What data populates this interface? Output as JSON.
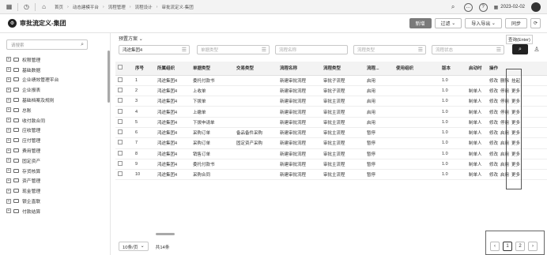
{
  "topbar": {
    "crumbs": [
      "首页",
      "动态建模平台",
      "流程管理",
      "流程设计",
      "审批流定义-集团"
    ],
    "date": "2023-02-02"
  },
  "header": {
    "title": "审批流定义-集团",
    "buttons": {
      "add": "新增",
      "filter": "过滤",
      "import_export": "导入导出",
      "sync": "同步"
    }
  },
  "sidebar": {
    "search_placeholder": "请搜索",
    "items": [
      {
        "label": "权限管理"
      },
      {
        "label": "基础数据"
      },
      {
        "label": "企业绩效管理平台"
      },
      {
        "label": "企业报表"
      },
      {
        "label": "基础档案及规则"
      },
      {
        "label": "总账"
      },
      {
        "label": "收付款合同"
      },
      {
        "label": "应收管理"
      },
      {
        "label": "应付管理"
      },
      {
        "label": "费用管理"
      },
      {
        "label": "固定资产"
      },
      {
        "label": "存货核算"
      },
      {
        "label": "资产管理"
      },
      {
        "label": "现金管理"
      },
      {
        "label": "银企直联"
      },
      {
        "label": "付款结算"
      }
    ]
  },
  "filters": {
    "scheme_label": "预置方案",
    "scheme_value": "",
    "org_value": "鸿途集团4",
    "doc_type_placeholder": "单据类型",
    "flow_name_placeholder": "流程名称",
    "flow_type_placeholder": "流程类型",
    "flow_status_placeholder": "流程状态",
    "search_tip": "查询(Enter)"
  },
  "table": {
    "columns": [
      "",
      "序号",
      "所属组织",
      "单据类型",
      "交易类型",
      "流程名称",
      "流程类型",
      "流程...",
      "使用组织",
      "版本",
      "启动时",
      "操作"
    ],
    "rows": [
      {
        "no": "1",
        "org": "鸿途集团4",
        "doc": "委托付款书",
        "trade": "",
        "name": "新建审批流程",
        "type": "审批子流程",
        "status": "启用",
        "use_org": "",
        "ver": "1.0",
        "start": "",
        "op1": "修改",
        "op2": "删除",
        "op3": "挂起"
      },
      {
        "no": "2",
        "org": "鸿途集团4",
        "doc": "上收单",
        "trade": "",
        "name": "新建审批流程",
        "type": "审批子流程",
        "status": "启用",
        "use_org": "",
        "ver": "1.0",
        "start": "制单人",
        "op1": "修改",
        "op2": "停用",
        "op3": "更多"
      },
      {
        "no": "3",
        "org": "鸿途集团4",
        "doc": "下拨单",
        "trade": "",
        "name": "新建审批流程",
        "type": "审批主流程",
        "status": "启用",
        "use_org": "",
        "ver": "1.0",
        "start": "制单人",
        "op1": "修改",
        "op2": "停用",
        "op3": "更多"
      },
      {
        "no": "4",
        "org": "鸿途集团4",
        "doc": "上缴单",
        "trade": "",
        "name": "新建审批流程",
        "type": "审批主流程",
        "status": "启用",
        "use_org": "",
        "ver": "1.0",
        "start": "制单人",
        "op1": "修改",
        "op2": "停用",
        "op3": "更多"
      },
      {
        "no": "5",
        "org": "鸿途集团4",
        "doc": "下拨申请单",
        "trade": "",
        "name": "新建审批流程",
        "type": "审批主流程",
        "status": "启用",
        "use_org": "",
        "ver": "1.0",
        "start": "制单人",
        "op1": "修改",
        "op2": "停用",
        "op3": "更多"
      },
      {
        "no": "6",
        "org": "鸿途集团4",
        "doc": "采购订单",
        "trade": "备品备件采购",
        "name": "新建审批流程",
        "type": "审批主流程",
        "status": "暂停",
        "use_org": "",
        "ver": "1.0",
        "start": "制单人",
        "op1": "修改",
        "op2": "启用",
        "op3": "更多"
      },
      {
        "no": "7",
        "org": "鸿途集团4",
        "doc": "采购订单",
        "trade": "固定资产采购",
        "name": "新建审批流程",
        "type": "审批主流程",
        "status": "暂停",
        "use_org": "",
        "ver": "1.0",
        "start": "制单人",
        "op1": "修改",
        "op2": "启用",
        "op3": "更多"
      },
      {
        "no": "8",
        "org": "鸿途集团4",
        "doc": "销售订单",
        "trade": "",
        "name": "新建审批流程",
        "type": "审批主流程",
        "status": "暂停",
        "use_org": "",
        "ver": "1.0",
        "start": "制单人",
        "op1": "修改",
        "op2": "启用",
        "op3": "更多"
      },
      {
        "no": "9",
        "org": "鸿途集团4",
        "doc": "委托付款书",
        "trade": "",
        "name": "新建审批流程",
        "type": "审批主流程",
        "status": "暂停",
        "use_org": "",
        "ver": "1.0",
        "start": "制单人",
        "op1": "修改",
        "op2": "启用",
        "op3": "更多"
      },
      {
        "no": "10",
        "org": "鸿途集团4",
        "doc": "采购合同",
        "trade": "",
        "name": "新建审批流程",
        "type": "审批主流程",
        "status": "暂停",
        "use_org": "",
        "ver": "1.0",
        "start": "制单人",
        "op1": "修改",
        "op2": "启用",
        "op3": "更多"
      }
    ]
  },
  "footer": {
    "page_size": "10条/页",
    "total": "共14条",
    "pages": [
      "1",
      "2"
    ]
  }
}
